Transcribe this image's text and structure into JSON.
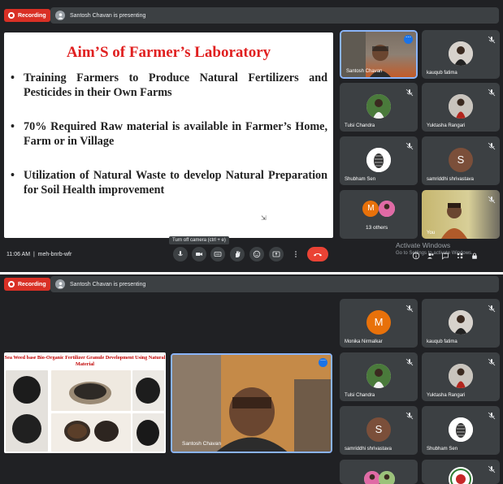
{
  "screen1": {
    "recording_label": "Recording",
    "presenting_text": "Santosh Chavan is presenting",
    "slide": {
      "title": "Aim’S of Farmer’s Laboratory",
      "bullets": [
        "Training Farmers to Produce Natural Fertilizers and Pesticides in their Own Farms",
        "70% Required Raw material is available in Farmer’s Home, Farm or in Village",
        "Utilization of Natural Waste to develop Natural Preparation for Soil Health improvement"
      ]
    },
    "participants": [
      {
        "name": "Santosh Chavan"
      },
      {
        "name": "kauqub fatima"
      },
      {
        "name": "Tulsi Chandra"
      },
      {
        "name": "Yuktasha Rangari"
      },
      {
        "name": "Shubham Sen"
      },
      {
        "name": "samriddhi shrivastava",
        "initial": "S"
      },
      {
        "name": "13 others",
        "initial": "M"
      },
      {
        "name": "You"
      }
    ],
    "time": "11:06 AM",
    "meeting_code": "meh-bnrb-wfr",
    "tooltip": "Turn off camera (ctrl + e)",
    "activate_title": "Activate Windows",
    "activate_sub": "Go to Settings to activate Windows.",
    "colors": {
      "accent": "#8ab4f8",
      "end_call": "#ea4335",
      "recording": "#d93025",
      "slide_title": "#e02020"
    }
  },
  "screen2": {
    "recording_label": "Recording",
    "presenting_text": "Santosh Chavan is presenting",
    "doc_title": "Sea Weed base Bio-Organic Fertilizer Granule Development Using Natural Material",
    "main_speaker": "Santosh Chavan",
    "participants": [
      {
        "name": "Monika Nirmalkar",
        "initial": "M"
      },
      {
        "name": "kauqub fatima"
      },
      {
        "name": "Tulsi Chandra"
      },
      {
        "name": "Yuktasha Rangari"
      },
      {
        "name": "samriddhi shrivastava",
        "initial": "S"
      },
      {
        "name": "Shubham Sen"
      }
    ]
  }
}
